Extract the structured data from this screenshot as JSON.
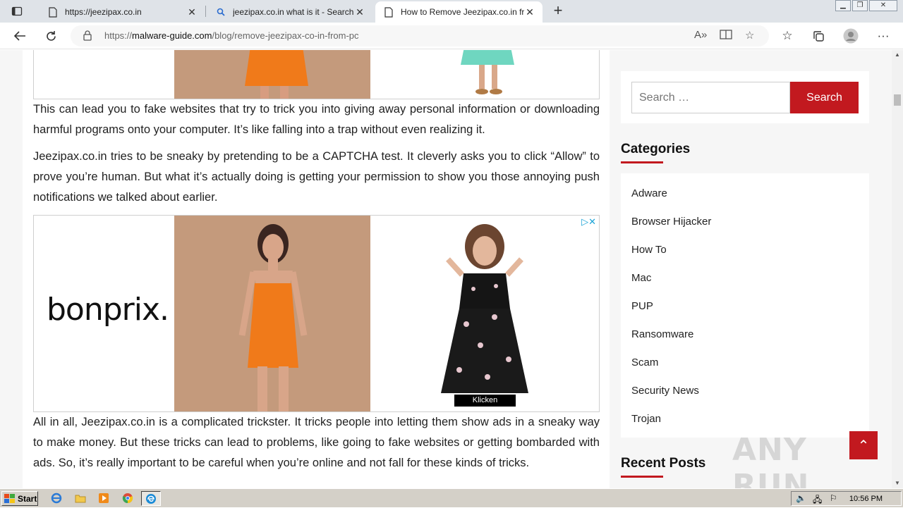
{
  "browser": {
    "tabs": [
      {
        "title": "https://jeezipax.co.in",
        "icon": "page-icon"
      },
      {
        "title": "jeezipax.co.in what is it - Search",
        "icon": "search-icon"
      },
      {
        "title": "How to Remove Jeezipax.co.in from PC",
        "icon": "page-icon"
      }
    ],
    "url_prefix": "https://",
    "url_domain": "malware-guide.com",
    "url_path": "/blog/remove-jeezipax-co-in-from-pc"
  },
  "article": {
    "paragraphs": [
      "This can lead you to fake websites that try to trick you into giving away personal information or downloading harmful programs onto your computer. It’s like falling into a trap without even realizing it.",
      "Jeezipax.co.in tries to be sneaky by pretending to be a CAPTCHA test. It cleverly asks you to click “Allow” to prove you’re human. But what it’s actually doing is getting your permission to show you those annoying push notifications we talked about earlier.",
      "All in all, Jeezipax.co.in is a complicated trickster. It tricks people into letting them show ads in a sneaky way to make money. But these tricks can lead to problems, like going to fake websites or getting bombarded with ads. So, it’s really important to be careful when you’re online and not fall for these kinds of tricks."
    ],
    "ad": {
      "brand": "bonprix.",
      "cta": "Klicken"
    }
  },
  "sidebar": {
    "search_placeholder": "Search …",
    "search_button": "Search",
    "categories_title": "Categories",
    "categories": [
      "Adware",
      "Browser Hijacker",
      "How To",
      "Mac",
      "PUP",
      "Ransomware",
      "Scam",
      "Security News",
      "Trojan"
    ],
    "recent_posts_title": "Recent Posts"
  },
  "watermark": "ANY RUN",
  "taskbar": {
    "start_label": "Start",
    "clock": "10:56 PM"
  },
  "colors": {
    "accent": "#c2191f",
    "tabstrip": "#dfe3e8",
    "taskbar": "#d4d0c8"
  }
}
